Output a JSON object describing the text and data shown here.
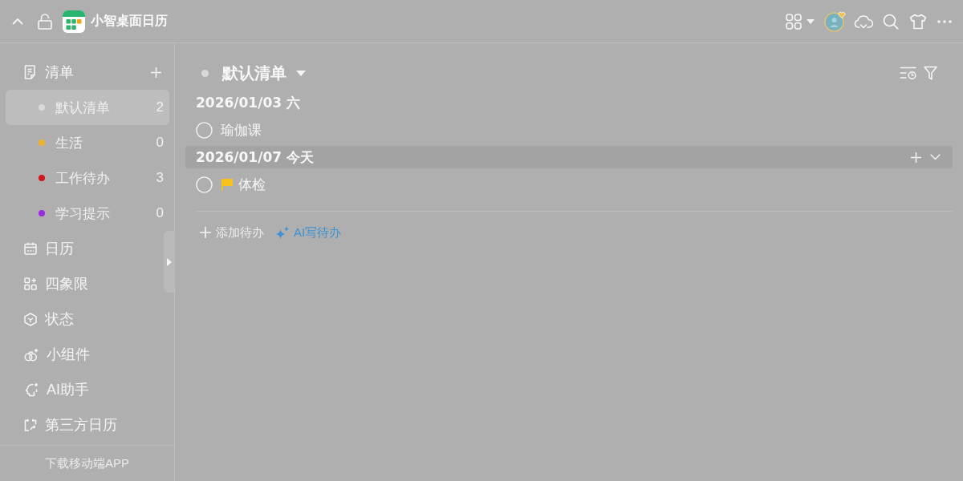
{
  "window": {
    "title": "小智桌面日历"
  },
  "sidebar": {
    "lists_header": {
      "label": "清单"
    },
    "lists": [
      {
        "name": "默认清单",
        "count": "2",
        "color": "#d9d9d9",
        "selected": true
      },
      {
        "name": "生活",
        "count": "0",
        "color": "#f0b22e",
        "selected": false
      },
      {
        "name": "工作待办",
        "count": "3",
        "color": "#d2171c",
        "selected": false
      },
      {
        "name": "学习提示",
        "count": "0",
        "color": "#9b2be0",
        "selected": false
      }
    ],
    "nav": [
      {
        "kind": "calendar",
        "label": "日历",
        "selected": false
      },
      {
        "kind": "quadrant",
        "label": "四象限",
        "selected": false
      },
      {
        "kind": "status",
        "label": "状态",
        "selected": false
      },
      {
        "kind": "widget",
        "label": "小组件",
        "selected": false
      },
      {
        "kind": "assistant",
        "label": "AI助手",
        "selected": false
      },
      {
        "kind": "external",
        "label": "第三方日历",
        "selected": false
      }
    ],
    "footer_link": "下载移动端APP"
  },
  "main": {
    "title": "默认清单",
    "groups": [
      {
        "date": "2026/01/03 六",
        "highlighted": false,
        "tasks": [
          {
            "title": "瑜伽课",
            "checked": false,
            "flagged": false
          }
        ]
      },
      {
        "date": "2026/01/07 今天",
        "highlighted": true,
        "tasks": [
          {
            "title": "体检",
            "checked": false,
            "flagged": true
          }
        ]
      }
    ],
    "actions": [
      {
        "kind": "add",
        "label": "添加待办"
      },
      {
        "kind": "ai",
        "label": "AI写待办"
      }
    ]
  }
}
